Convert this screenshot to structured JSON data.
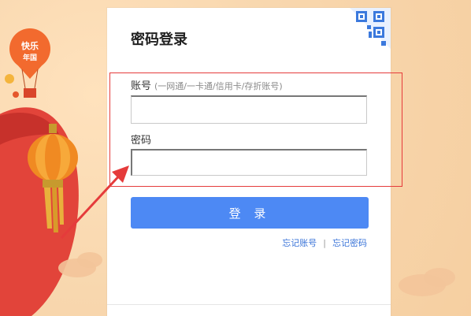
{
  "login": {
    "title": "密码登录",
    "account_label": "账号",
    "account_hint": "(一网通/一卡通/信用卡/存折账号)",
    "account_value": "",
    "password_label": "密码",
    "password_value": "",
    "login_button": "登 录",
    "forgot_account": "忘记账号",
    "separator": "|",
    "forgot_password": "忘记密码"
  },
  "decor": {
    "balloon_text": "快乐年国",
    "brand_color": "#4d89f4",
    "highlight_color": "#e53b3b",
    "qr_icon": "qr-code-icon"
  }
}
